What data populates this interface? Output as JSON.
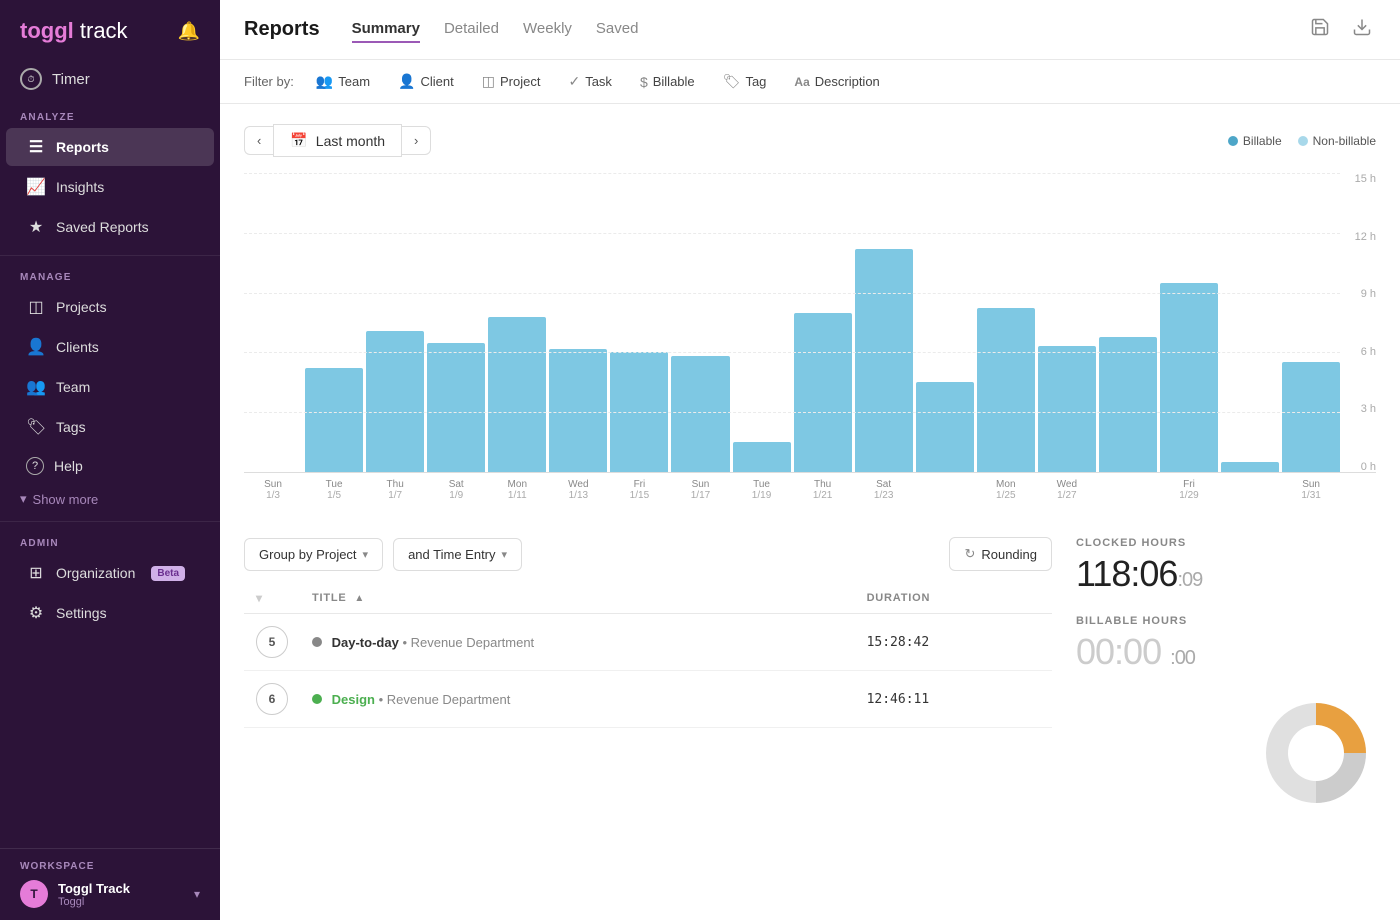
{
  "app": {
    "logo_toggl": "toggl",
    "logo_track": "track"
  },
  "sidebar": {
    "timer_label": "Timer",
    "sections": [
      {
        "label": "ANALYZE",
        "items": [
          {
            "id": "reports",
            "label": "Reports",
            "icon": "☰",
            "active": true
          },
          {
            "id": "insights",
            "label": "Insights",
            "icon": "📈"
          },
          {
            "id": "saved-reports",
            "label": "Saved Reports",
            "icon": "★"
          }
        ]
      },
      {
        "label": "MANAGE",
        "items": [
          {
            "id": "projects",
            "label": "Projects",
            "icon": "◫"
          },
          {
            "id": "clients",
            "label": "Clients",
            "icon": "👤"
          },
          {
            "id": "team",
            "label": "Team",
            "icon": "👥"
          },
          {
            "id": "tags",
            "label": "Tags",
            "icon": "🏷"
          },
          {
            "id": "help",
            "label": "Help",
            "icon": "?"
          }
        ]
      }
    ],
    "show_more": "Show more",
    "admin_section": "ADMIN",
    "admin_items": [
      {
        "id": "organization",
        "label": "Organization",
        "badge": "Beta"
      },
      {
        "id": "settings",
        "label": "Settings"
      }
    ],
    "workspace_section": "WORKSPACE",
    "workspace_name": "Toggl Track",
    "workspace_sub": "Toggl"
  },
  "header": {
    "title": "Reports",
    "tabs": [
      {
        "id": "summary",
        "label": "Summary",
        "active": true
      },
      {
        "id": "detailed",
        "label": "Detailed"
      },
      {
        "id": "weekly",
        "label": "Weekly"
      },
      {
        "id": "saved",
        "label": "Saved"
      }
    ]
  },
  "filters": {
    "label": "Filter by:",
    "items": [
      {
        "id": "team",
        "label": "Team",
        "icon": "👥"
      },
      {
        "id": "client",
        "label": "Client",
        "icon": "👤"
      },
      {
        "id": "project",
        "label": "Project",
        "icon": "◫"
      },
      {
        "id": "task",
        "label": "Task",
        "icon": "✓"
      },
      {
        "id": "billable",
        "label": "Billable",
        "icon": "$"
      },
      {
        "id": "tag",
        "label": "Tag",
        "icon": "🏷"
      },
      {
        "id": "description",
        "label": "Description",
        "icon": "Aa"
      }
    ]
  },
  "date_range": {
    "current": "Last month",
    "legend": [
      {
        "label": "Billable",
        "color": "#4da6c8"
      },
      {
        "label": "Non-billable",
        "color": "#a8d8ea"
      }
    ]
  },
  "chart": {
    "y_labels": [
      "15 h",
      "12 h",
      "9 h",
      "6 h",
      "3 h",
      "0 h"
    ],
    "max_hours": 15,
    "x_groups": [
      {
        "day": "Sun",
        "date": "1/3",
        "bars": [
          0
        ]
      },
      {
        "day": "Tue",
        "date": "1/5",
        "bars": [
          5.2
        ]
      },
      {
        "day": "Thu",
        "date": "1/7",
        "bars": [
          7.1
        ]
      },
      {
        "day": "Sat",
        "date": "1/9",
        "bars": [
          6.5
        ]
      },
      {
        "day": "Mon",
        "date": "1/11",
        "bars": [
          7.8
        ]
      },
      {
        "day": "Wed",
        "date": "1/13",
        "bars": [
          6.2
        ]
      },
      {
        "day": "Fri",
        "date": "1/15",
        "bars": [
          6.0
        ]
      },
      {
        "day": "Sun",
        "date": "1/17",
        "bars": [
          5.8
        ]
      },
      {
        "day": "Tue",
        "date": "1/19",
        "bars": [
          1.5
        ]
      },
      {
        "day": "Thu",
        "date": "1/21",
        "bars": [
          8.0
        ]
      },
      {
        "day": "Sat",
        "date": "1/23",
        "bars": [
          11.2
        ]
      },
      {
        "day": "Mon",
        "date": "1/25",
        "bars": [
          4.5
        ]
      },
      {
        "day": "Wed",
        "date": "1/27",
        "bars": [
          8.2
        ]
      },
      {
        "day": "Fri",
        "date": "1/29",
        "bars": [
          7.8
        ]
      },
      {
        "day": "Sun",
        "date": "1/31",
        "bars": [
          5.5
        ]
      },
      {
        "day": "",
        "date": "",
        "bars": [
          4.5
        ]
      },
      {
        "day": "",
        "date": "",
        "bars": [
          5.0
        ]
      },
      {
        "day": "",
        "date": "",
        "bars": [
          4.2
        ]
      },
      {
        "day": "",
        "date": "",
        "bars": [
          9.5
        ]
      },
      {
        "day": "",
        "date": "",
        "bars": [
          0.5
        ]
      }
    ]
  },
  "table": {
    "group_by_label": "Group by Project",
    "group_by_secondary": "and Time Entry",
    "rounding_label": "Rounding",
    "columns": [
      {
        "id": "check",
        "label": ""
      },
      {
        "id": "title",
        "label": "TITLE",
        "sortable": true
      },
      {
        "id": "duration",
        "label": "DURATION"
      }
    ],
    "rows": [
      {
        "num": 5,
        "project": "Day-to-day",
        "dot_color": "#888",
        "client": "Revenue Department",
        "duration": "15:28:42"
      },
      {
        "num": 6,
        "project": "Design",
        "dot_color": "#4caf50",
        "client": "Revenue Department",
        "duration": "12:46:11"
      }
    ]
  },
  "stats": {
    "clocked_label": "CLOCKED HOURS",
    "clocked_hours": "118:06",
    "clocked_seconds": "09",
    "billable_label": "BILLABLE HOURS",
    "billable_hours": "0:00",
    "billable_seconds": "00"
  }
}
